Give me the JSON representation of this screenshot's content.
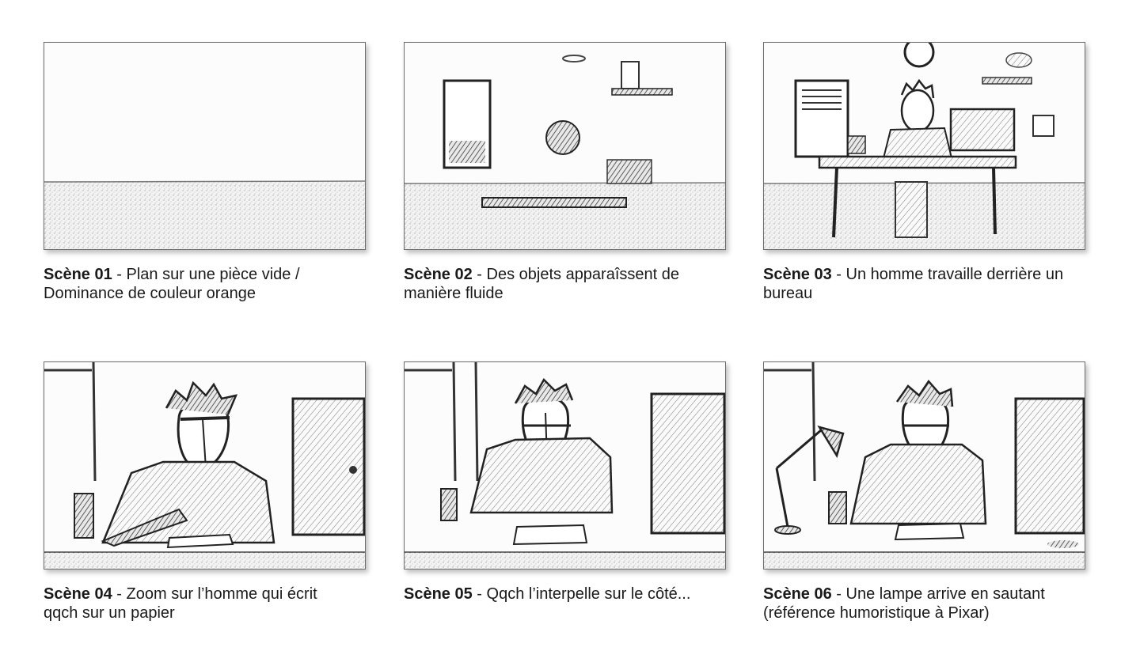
{
  "scenes": [
    {
      "label": "Scène 01",
      "sep": " - ",
      "desc": "Plan sur une pièce vide / Dominance de couleur orange"
    },
    {
      "label": "Scène 02",
      "sep": " - ",
      "desc": "Des objets apparaîssent de manière fluide"
    },
    {
      "label": "Scène 03",
      "sep": " - ",
      "desc": "Un homme travaille derrière un bureau"
    },
    {
      "label": "Scène 04",
      "sep": " - ",
      "desc": "Zoom sur l’homme qui écrit qqch sur un papier"
    },
    {
      "label": "Scène 05",
      "sep": " - ",
      "desc": "Qqch l’interpelle sur le côté..."
    },
    {
      "label": "Scène 06",
      "sep": " - ",
      "desc": "Une lampe arrive en sautant (référence humoristique à Pixar)"
    }
  ],
  "colors": {
    "ink": "#1a1a1a",
    "pencil": "#333333",
    "paper": "#fbfbfb"
  }
}
